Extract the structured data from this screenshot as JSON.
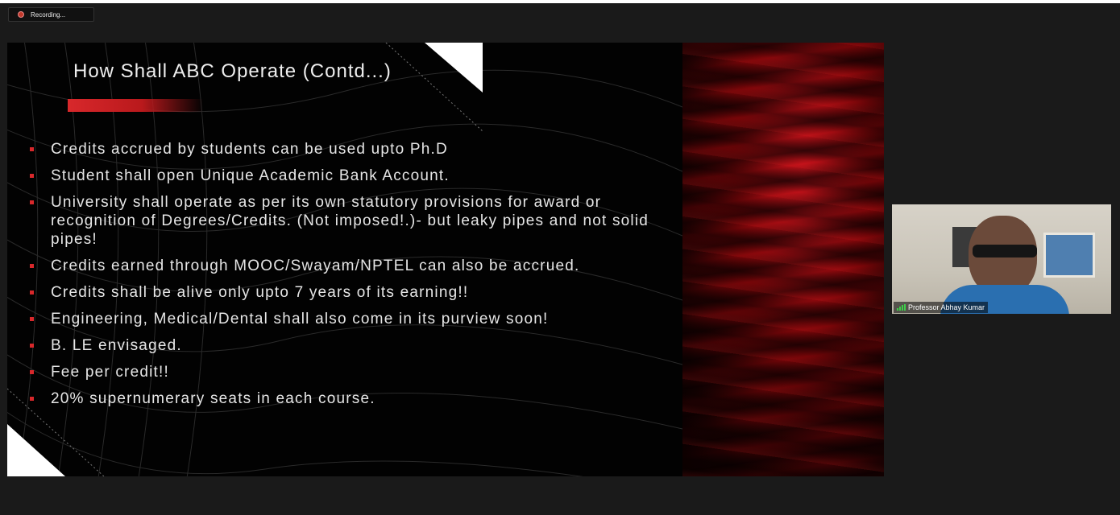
{
  "recording": {
    "label": "Recording..."
  },
  "slide": {
    "title": "How Shall ABC Operate (Contd...)",
    "bullets": [
      "Credits accrued by students can be used  upto Ph.D",
      "Student shall open Unique Academic Bank Account.",
      "University shall operate as per its own statutory provisions for award or recognition of Degrees/Credits. (Not imposed!.)- but leaky pipes and not solid pipes!",
      "Credits earned through MOOC/Swayam/NPTEL can also be accrued.",
      "Credits shall be alive only upto 7 years of its earning!!",
      "Engineering, Medical/Dental shall also come in its purview soon!",
      "B. LE envisaged.",
      "Fee per credit!!",
      "20% supernumerary seats in each course."
    ],
    "accent_color": "#d8282b"
  },
  "participant": {
    "name": "Professor  Abhay Kumar",
    "signal_icon": "signal-strength-icon"
  }
}
